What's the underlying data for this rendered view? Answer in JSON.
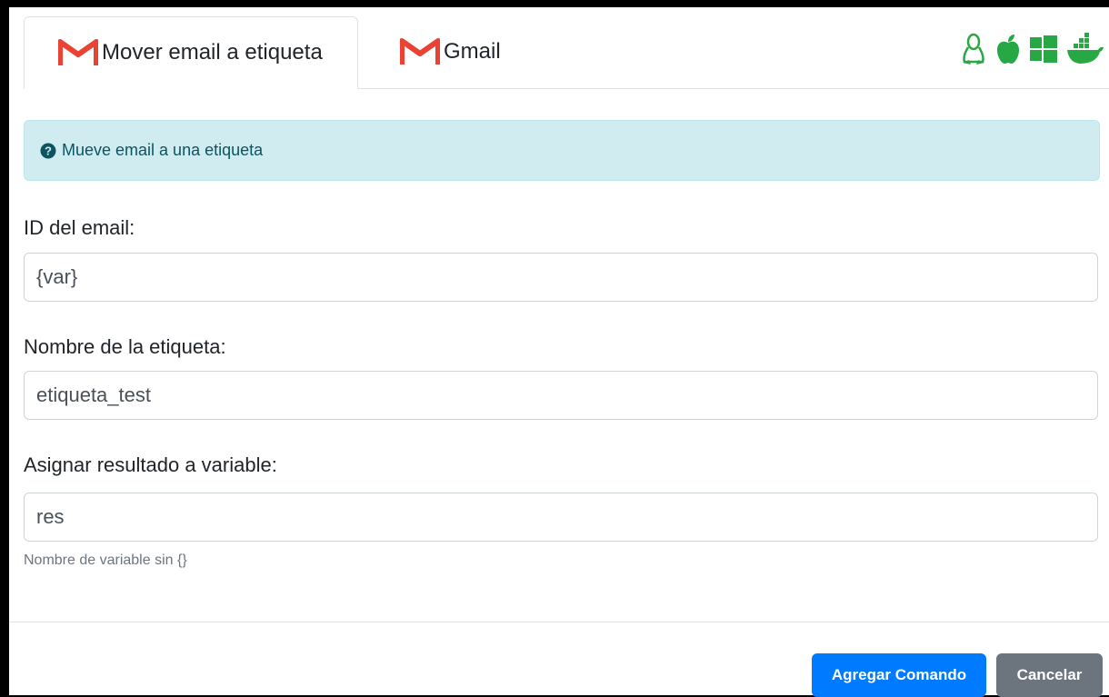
{
  "tabs": [
    {
      "label": "Mover email a etiqueta",
      "icon": "gmail-icon",
      "active": true
    },
    {
      "label": "Gmail",
      "icon": "gmail-icon",
      "active": false
    }
  ],
  "os_icons": [
    "linux-icon",
    "apple-icon",
    "windows-icon",
    "docker-icon"
  ],
  "colors": {
    "os_icon": "#28a745",
    "gmail": "#ea4335",
    "primary": "#007bff",
    "secondary": "#6c757d",
    "info_bg": "#d1ecf1",
    "info_text": "#0c5460"
  },
  "alert": {
    "icon": "question-circle-icon",
    "text": "Mueve email a una etiqueta"
  },
  "form": {
    "email_id": {
      "label": "ID del email:",
      "value": "{var}"
    },
    "label_name": {
      "label": "Nombre de la etiqueta:",
      "value": "etiqueta_test"
    },
    "result_var": {
      "label": "Asignar resultado a variable:",
      "value": "res",
      "help": "Nombre de variable sin {}"
    }
  },
  "buttons": {
    "add": "Agregar Comando",
    "cancel": "Cancelar"
  }
}
